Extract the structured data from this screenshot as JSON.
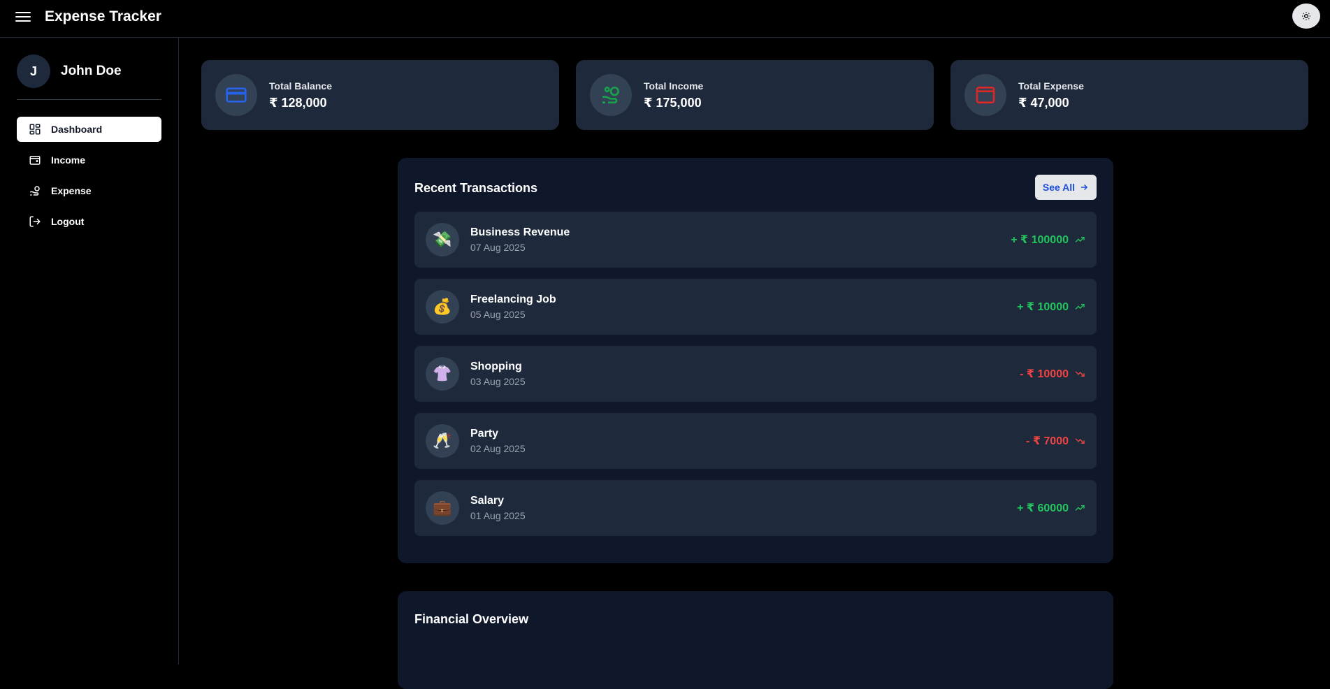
{
  "header": {
    "title": "Expense Tracker",
    "menu_icon": "hamburger-icon",
    "theme_icon": "sun-icon"
  },
  "sidebar": {
    "avatar_initial": "J",
    "username": "John Doe",
    "items": [
      {
        "label": "Dashboard",
        "icon": "dashboard-icon",
        "active": true
      },
      {
        "label": "Income",
        "icon": "wallet-icon",
        "active": false
      },
      {
        "label": "Expense",
        "icon": "hand-coins-icon",
        "active": false
      },
      {
        "label": "Logout",
        "icon": "logout-icon",
        "active": false
      }
    ]
  },
  "summary": [
    {
      "label": "Total Balance",
      "value": "₹ 128,000",
      "icon": "credit-card-icon",
      "color": "#2563eb"
    },
    {
      "label": "Total Income",
      "value": "₹ 175,000",
      "icon": "hand-coins-icon",
      "color": "#16a34a"
    },
    {
      "label": "Total Expense",
      "value": "₹ 47,000",
      "icon": "wallet-icon",
      "color": "#dc2626"
    }
  ],
  "recent": {
    "title": "Recent Transactions",
    "see_all": "See All",
    "transactions": [
      {
        "name": "Business Revenue",
        "date": "07 Aug 2025",
        "sign": "+ ₹ ",
        "amount": "100000",
        "type": "income",
        "emoji": "💸"
      },
      {
        "name": "Freelancing Job",
        "date": "05 Aug 2025",
        "sign": "+ ₹ ",
        "amount": "10000",
        "type": "income",
        "emoji": "💰"
      },
      {
        "name": "Shopping",
        "date": "03 Aug 2025",
        "sign": "- ₹ ",
        "amount": "10000",
        "type": "expense",
        "emoji": "👚"
      },
      {
        "name": "Party",
        "date": "02 Aug 2025",
        "sign": "- ₹ ",
        "amount": "7000",
        "type": "expense",
        "emoji": "🥂"
      },
      {
        "name": "Salary",
        "date": "01 Aug 2025",
        "sign": "+ ₹ ",
        "amount": "60000",
        "type": "income",
        "emoji": "💼"
      }
    ]
  },
  "overview": {
    "title": "Financial Overview"
  },
  "colors": {
    "income": "#22c55e",
    "expense": "#ef4444",
    "card": "#1e293b",
    "panel": "#0f172a"
  }
}
